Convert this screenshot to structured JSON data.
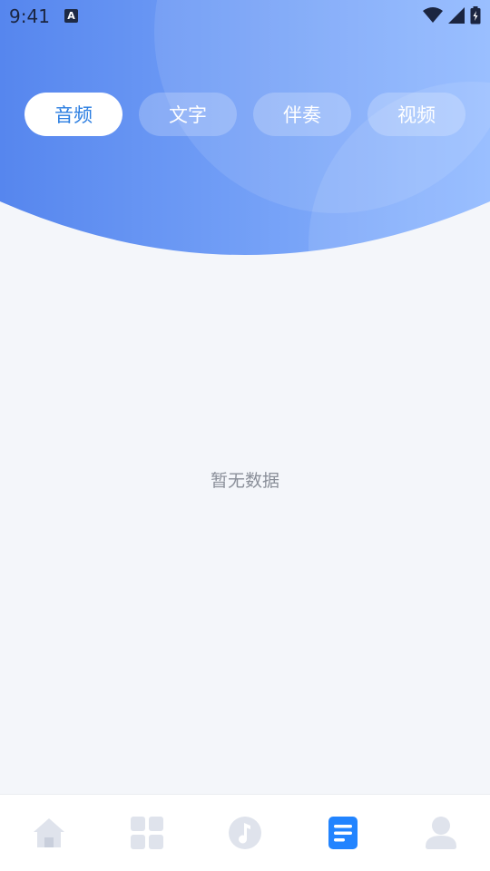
{
  "status_bar": {
    "time": "9:41",
    "notification_letter": "A",
    "icons": [
      "wifi-icon",
      "signal-icon",
      "battery-icon"
    ]
  },
  "tabs": [
    {
      "label": "音频",
      "active": true
    },
    {
      "label": "文字",
      "active": false
    },
    {
      "label": "伴奏",
      "active": false
    },
    {
      "label": "视频",
      "active": false
    }
  ],
  "empty_state": {
    "text": "暂无数据"
  },
  "bottom_nav": [
    {
      "name": "home-icon",
      "active": false
    },
    {
      "name": "apps-icon",
      "active": false
    },
    {
      "name": "music-icon",
      "active": false
    },
    {
      "name": "document-icon",
      "active": true
    },
    {
      "name": "profile-icon",
      "active": false
    }
  ],
  "colors": {
    "header_start": "#5a8cf0",
    "header_end": "#8cb6ff",
    "active_tab_text": "#2a7de1",
    "nav_inactive": "#dfe3ec",
    "nav_active": "#2284ff",
    "background": "#f4f6fa"
  }
}
